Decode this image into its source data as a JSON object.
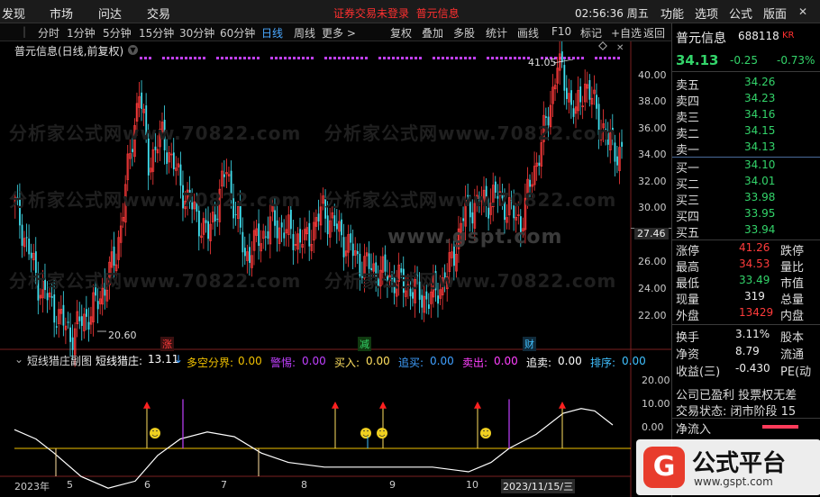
{
  "menubar": {
    "items": [
      "发现",
      "市场",
      "问达",
      "交易"
    ],
    "notice": "证券交易未登录",
    "stock": "普元信息",
    "clock": "02:56:36 周五",
    "right_items": [
      "功能",
      "选项",
      "公式",
      "版面"
    ]
  },
  "toolbar": {
    "periods": [
      "分时",
      "1分钟",
      "5分钟",
      "15分钟",
      "30分钟",
      "60分钟",
      "日线",
      "周线",
      "更多 >"
    ],
    "active_period": "日线",
    "tools": [
      "复权",
      "叠加",
      "多股",
      "统计",
      "画线",
      "F10",
      "标记",
      "+自选",
      "返回"
    ]
  },
  "chart": {
    "title": "普元信息(日线,前复权)",
    "y_ticks": [
      "40.00",
      "38.00",
      "36.00",
      "34.00",
      "32.00",
      "30.00",
      "26.00",
      "24.00",
      "22.00"
    ],
    "price_marker": "27.46",
    "high_label": "41.05",
    "low_label": "20.60",
    "event_marks": [
      "涨",
      "减",
      "财"
    ],
    "watermark": "分析家公式网www.70822.com",
    "center_watermark": "www.gspt.com",
    "x_labels": [
      "2023年",
      "5",
      "6",
      "7",
      "8",
      "9",
      "10",
      "2023/11/15/三"
    ],
    "sub": {
      "name": "短线猎庄副图",
      "indicator": "短线猎庄:",
      "indicator_value": "13.11",
      "fields": [
        {
          "label": "多空分界:",
          "value": "0.00",
          "color": "#f0c000"
        },
        {
          "label": "警惕:",
          "value": "0.00",
          "color": "#c040ff"
        },
        {
          "label": "买入:",
          "value": "0.00",
          "color": "#ffe060"
        },
        {
          "label": "追买:",
          "value": "0.00",
          "color": "#40a0ff"
        },
        {
          "label": "卖出:",
          "value": "0.00",
          "color": "#ff40ff"
        },
        {
          "label": "追卖:",
          "value": "0.00",
          "color": "#ffffff"
        },
        {
          "label": "排序:",
          "value": "0.00",
          "color": "#40c0ff"
        }
      ],
      "y_ticks": [
        "20.00",
        "10.00",
        "0.00"
      ]
    }
  },
  "quote": {
    "name": "普元信息",
    "code": "688118",
    "tag": "KR",
    "price": "34.13",
    "change": "-0.25",
    "change_pct": "-0.73%",
    "sells": [
      {
        "label": "卖五",
        "price": "34.26"
      },
      {
        "label": "卖四",
        "price": "34.23"
      },
      {
        "label": "卖三",
        "price": "34.16"
      },
      {
        "label": "卖二",
        "price": "34.15"
      },
      {
        "label": "卖一",
        "price": "34.13"
      }
    ],
    "buys": [
      {
        "label": "买一",
        "price": "34.10"
      },
      {
        "label": "买二",
        "price": "34.01"
      },
      {
        "label": "买三",
        "price": "33.98"
      },
      {
        "label": "买四",
        "price": "33.95"
      },
      {
        "label": "买五",
        "price": "33.94"
      }
    ],
    "stats": [
      {
        "label": "涨停",
        "value": "41.26",
        "color": "red",
        "label2": "跌停"
      },
      {
        "label": "最高",
        "value": "34.53",
        "color": "red",
        "label2": "量比"
      },
      {
        "label": "最低",
        "value": "33.49",
        "color": "green",
        "label2": "市值"
      },
      {
        "label": "现量",
        "value": "319",
        "color": "white",
        "label2": "总量"
      },
      {
        "label": "外盘",
        "value": "13429",
        "color": "red",
        "label2": "内盘"
      }
    ],
    "stats2": [
      {
        "label": "换手",
        "value": "3.11%",
        "label2": "股本"
      },
      {
        "label": "净资",
        "value": "8.79",
        "label2": "流通"
      },
      {
        "label": "收益(三)",
        "value": "-0.430",
        "label2": "PE(动"
      }
    ],
    "info": [
      "公司已盈利 投票权无差",
      "交易状态: 闭市阶段 15"
    ],
    "netflow": "净流入"
  },
  "colors": {
    "up": "#ff3b3b",
    "down": "#40e0f0",
    "green": "#33d46a",
    "accent": "#4aa8ff"
  },
  "brand": "公式平台",
  "brand_url": "www.gspt.com"
}
